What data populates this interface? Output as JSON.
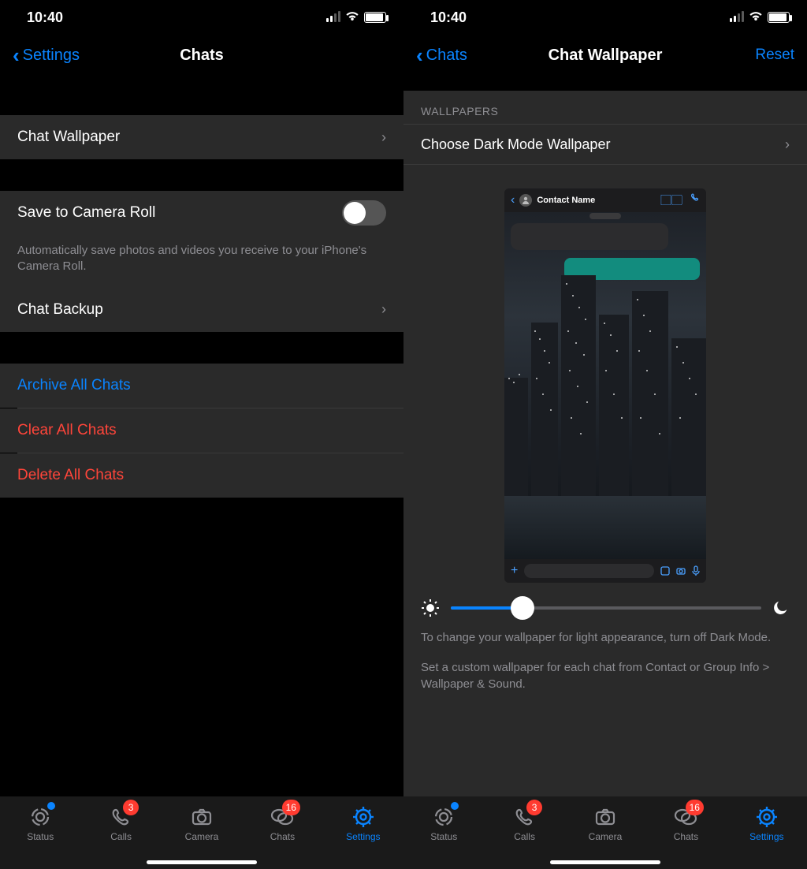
{
  "time": "10:40",
  "left": {
    "back": "Settings",
    "title": "Chats",
    "rows": {
      "wallpaper": "Chat Wallpaper",
      "save": "Save to Camera Roll",
      "save_desc": "Automatically save photos and videos you receive to your iPhone's Camera Roll.",
      "backup": "Chat Backup",
      "archive": "Archive All Chats",
      "clear": "Clear All Chats",
      "delete": "Delete All Chats"
    }
  },
  "right": {
    "back": "Chats",
    "title": "Chat Wallpaper",
    "action": "Reset",
    "section": "WALLPAPERS",
    "choose": "Choose Dark Mode Wallpaper",
    "preview_contact": "Contact Name",
    "hint1": "To change your wallpaper for light appearance, turn off Dark Mode.",
    "hint2": "Set a custom wallpaper for each chat from Contact or Group Info > Wallpaper & Sound."
  },
  "tabs": {
    "status": "Status",
    "calls": "Calls",
    "camera": "Camera",
    "chats": "Chats",
    "settings": "Settings",
    "badge_calls": "3",
    "badge_chats": "16"
  }
}
